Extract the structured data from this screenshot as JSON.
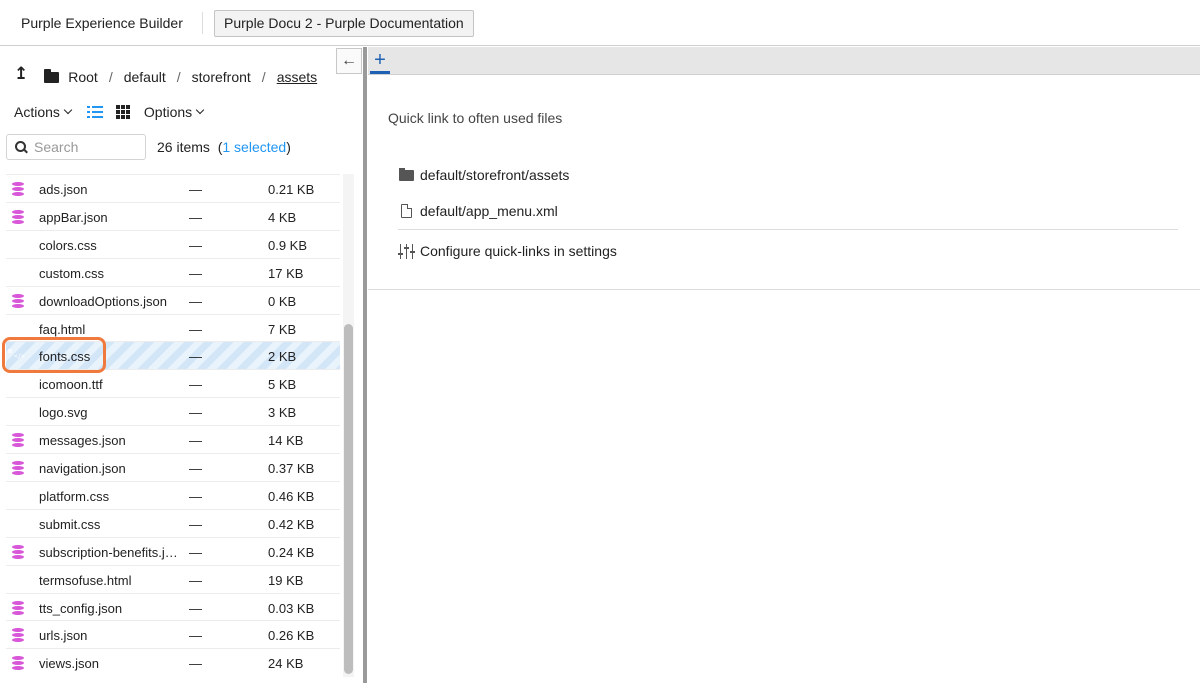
{
  "app": {
    "title": "Purple Experience Builder",
    "document_tab": "Purple Docu 2 - Purple Documentation"
  },
  "breadcrumb": {
    "items": [
      "Root",
      "default",
      "storefront",
      "assets"
    ],
    "separator": "/"
  },
  "toolbar": {
    "actions_label": "Actions",
    "options_label": "Options"
  },
  "search": {
    "placeholder": "Search",
    "value": ""
  },
  "summary": {
    "count_text": "26 items",
    "open_paren": "(",
    "selected_text": "1 selected",
    "close_paren": ")"
  },
  "files": [
    {
      "name": "ads.json",
      "modified": "—",
      "size": "0.21 KB",
      "icon": "database-icon"
    },
    {
      "name": "appBar.json",
      "modified": "—",
      "size": "4 KB",
      "icon": "database-icon"
    },
    {
      "name": "colors.css",
      "modified": "—",
      "size": "0.9 KB",
      "icon": "code-file-icon"
    },
    {
      "name": "custom.css",
      "modified": "—",
      "size": "17 KB",
      "icon": "code-file-icon"
    },
    {
      "name": "downloadOptions.json",
      "modified": "—",
      "size": "0 KB",
      "icon": "database-icon"
    },
    {
      "name": "faq.html",
      "modified": "—",
      "size": "7 KB",
      "icon": "html-file-icon"
    },
    {
      "name": "fonts.css",
      "modified": "—",
      "size": "2 KB",
      "icon": "code-file-icon",
      "selected": true
    },
    {
      "name": "icomoon.ttf",
      "modified": "—",
      "size": "5 KB",
      "icon": "file-icon"
    },
    {
      "name": "logo.svg",
      "modified": "—",
      "size": "3 KB",
      "icon": "image-file-icon"
    },
    {
      "name": "messages.json",
      "modified": "—",
      "size": "14 KB",
      "icon": "database-icon"
    },
    {
      "name": "navigation.json",
      "modified": "—",
      "size": "0.37 KB",
      "icon": "database-icon"
    },
    {
      "name": "platform.css",
      "modified": "—",
      "size": "0.46 KB",
      "icon": "code-file-icon"
    },
    {
      "name": "submit.css",
      "modified": "—",
      "size": "0.42 KB",
      "icon": "code-file-icon"
    },
    {
      "name": "subscription-benefits.j…",
      "modified": "—",
      "size": "0.24 KB",
      "icon": "database-icon"
    },
    {
      "name": "termsofuse.html",
      "modified": "—",
      "size": "19 KB",
      "icon": "html-file-icon"
    },
    {
      "name": "tts_config.json",
      "modified": "—",
      "size": "0.03 KB",
      "icon": "database-icon"
    },
    {
      "name": "urls.json",
      "modified": "—",
      "size": "0.26 KB",
      "icon": "database-icon"
    },
    {
      "name": "views.json",
      "modified": "—",
      "size": "24 KB",
      "icon": "database-icon"
    }
  ],
  "workspace": {
    "new_tab_label": "+",
    "quick_links_title": "Quick link to often used files",
    "quick_links": [
      {
        "label": "default/storefront/assets",
        "icon": "folder-open-icon"
      },
      {
        "label": "default/app_menu.xml",
        "icon": "file-icon"
      }
    ],
    "configure_label": "Configure quick-links in settings"
  },
  "colors": {
    "accent": "#2196f3",
    "selection_highlight": "#f07a3e",
    "json_icon": "#d856d8",
    "css_icon": "#7ccd5a",
    "html_icon": "#e8cb4d"
  }
}
